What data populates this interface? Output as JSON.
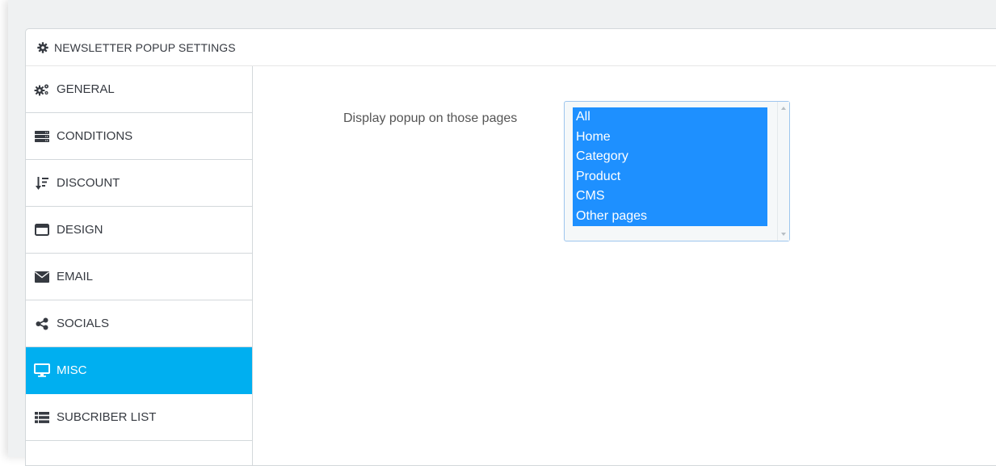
{
  "panel": {
    "title": "NEWSLETTER POPUP SETTINGS",
    "title_icon": "gear-icon"
  },
  "sidebar": {
    "items": [
      {
        "label": "GENERAL",
        "icon": "gears-icon",
        "active": false
      },
      {
        "label": "CONDITIONS",
        "icon": "server-icon",
        "active": false
      },
      {
        "label": "DISCOUNT",
        "icon": "sort-amount-icon",
        "active": false
      },
      {
        "label": "DESIGN",
        "icon": "window-icon",
        "active": false
      },
      {
        "label": "EMAIL",
        "icon": "envelope-icon",
        "active": false
      },
      {
        "label": "SOCIALS",
        "icon": "share-icon",
        "active": false
      },
      {
        "label": "MISC",
        "icon": "desktop-icon",
        "active": true
      },
      {
        "label": "SUBCRIBER LIST",
        "icon": "list-icon",
        "active": false
      }
    ]
  },
  "form": {
    "pages_label": "Display popup on those pages",
    "pages_options": [
      "All",
      "Home",
      "Category",
      "Product",
      "CMS",
      "Other pages"
    ],
    "pages_selected": [
      "All",
      "Home",
      "Category",
      "Product",
      "CMS",
      "Other pages"
    ]
  },
  "colors": {
    "accent": "#00aff0",
    "selection": "#1e90ff",
    "text": "#363a41"
  }
}
